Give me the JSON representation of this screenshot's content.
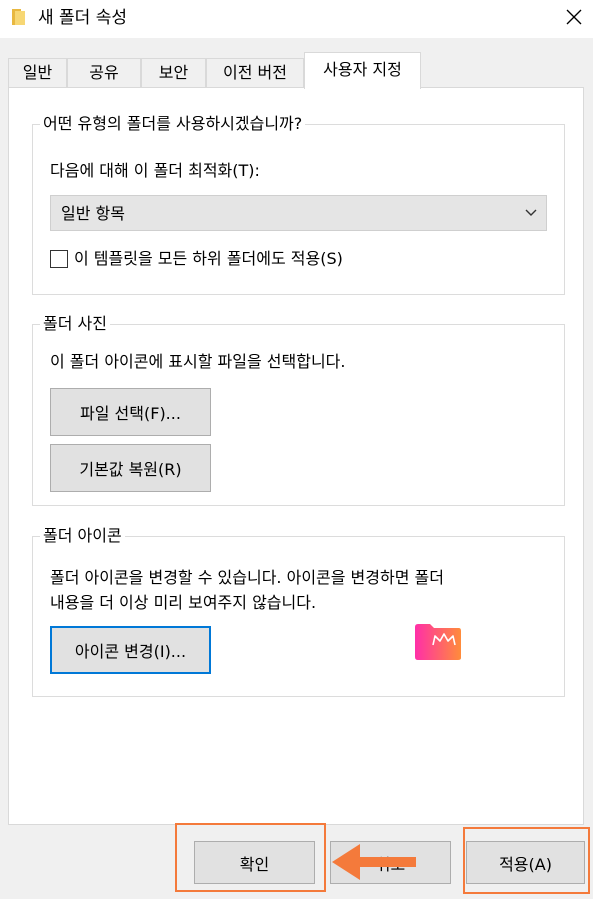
{
  "window": {
    "title": "새 폴더 속성",
    "folder_icon": "folder-icon",
    "close_icon": "close-icon"
  },
  "tabs": [
    {
      "label": "일반",
      "active": false
    },
    {
      "label": "공유",
      "active": false
    },
    {
      "label": "보안",
      "active": false
    },
    {
      "label": "이전 버전",
      "active": false
    },
    {
      "label": "사용자 지정",
      "active": true
    }
  ],
  "optimize_group": {
    "legend": "어떤 유형의 폴더를 사용하시겠습니까?",
    "label": "다음에 대해 이 폴더 최적화(T):",
    "dropdown_value": "일반 항목",
    "checkbox_label": "이 템플릿을 모든 하위 폴더에도 적용(S)",
    "checkbox_checked": false
  },
  "picture_group": {
    "legend": "폴더 사진",
    "description": "이 폴더 아이콘에 표시할 파일을 선택합니다.",
    "choose_file_button": "파일 선택(F)...",
    "restore_default_button": "기본값 복원(R)"
  },
  "icon_group": {
    "legend": "폴더 아이콘",
    "description_line1": "폴더 아이콘을 변경할 수 있습니다. 아이콘을 변경하면 폴더",
    "description_line2": "내용을 더 이상  미리 보여주지 않습니다.",
    "change_icon_button": "아이콘 변경(I)...",
    "preview_icon": "crown-folder-icon"
  },
  "footer": {
    "ok_button": "확인",
    "cancel_button": "취소",
    "apply_button": "적용(A)"
  },
  "colors": {
    "annotation_orange": "#f47a3b",
    "focus_blue": "#0078d7",
    "icon_gradient_start": "#ff2fa8",
    "icon_gradient_end": "#ff8c3a"
  }
}
